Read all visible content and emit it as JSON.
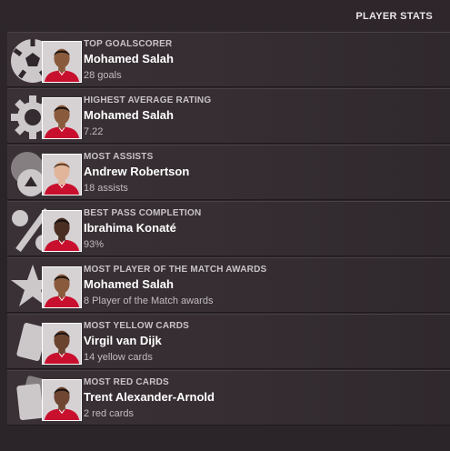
{
  "header": {
    "title": "PLAYER STATS"
  },
  "stats": [
    {
      "icon": "football-icon",
      "category": "TOP GOALSCORER",
      "player": "Mohamed Salah",
      "value": "28 goals",
      "skin": "#8a5a3c",
      "hair": "#1a120e"
    },
    {
      "icon": "rating-badge-icon",
      "category": "HIGHEST AVERAGE RATING",
      "player": "Mohamed Salah",
      "value": "7.22",
      "skin": "#8a5a3c",
      "hair": "#1a120e"
    },
    {
      "icon": "assist-icon",
      "category": "MOST ASSISTS",
      "player": "Andrew Robertson",
      "value": "18 assists",
      "skin": "#e0b59a",
      "hair": "#5a3a22"
    },
    {
      "icon": "percent-icon",
      "category": "BEST PASS COMPLETION",
      "player": "Ibrahima Konaté",
      "value": "93%",
      "skin": "#4a2e22",
      "hair": "#151010"
    },
    {
      "icon": "star-icon",
      "category": "MOST PLAYER OF THE MATCH AWARDS",
      "player": "Mohamed Salah",
      "value": "8 Player of the Match awards",
      "skin": "#8a5a3c",
      "hair": "#1a120e"
    },
    {
      "icon": "yellow-card-icon",
      "category": "MOST YELLOW CARDS",
      "player": "Virgil van Dijk",
      "value": "14 yellow cards",
      "skin": "#6b4430",
      "hair": "#1a120e"
    },
    {
      "icon": "red-card-icon",
      "category": "MOST RED CARDS",
      "player": "Trent Alexander-Arnold",
      "value": "2 red cards",
      "skin": "#6e4632",
      "hair": "#1a120e"
    }
  ],
  "colors": {
    "kit": "#c8102e",
    "background": "#2a2327",
    "icon": "#dcd8da"
  }
}
